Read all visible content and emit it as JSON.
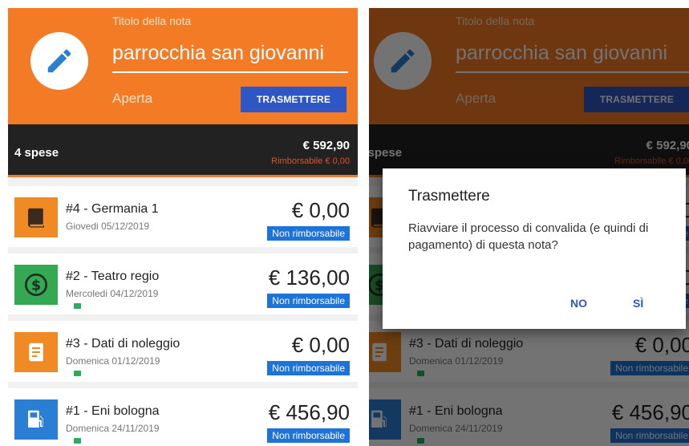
{
  "note": {
    "title_label": "Titolo della nota",
    "title_value": "parrocchia san giovanni",
    "status": "Aperta",
    "transmit_label": "TRASMETTERE"
  },
  "summary": {
    "count_label": "4 spese",
    "total": "€ 592,90",
    "reimbursable": "Rimborsabile  € 0,00"
  },
  "expenses": [
    {
      "title": "#4 - Germania 1",
      "date": "Giovedi 05/12/2019",
      "amount": "€ 0,00",
      "badge": "Non rimborsabile",
      "icon": "book-icon",
      "color": "#f08a24",
      "attachment": false
    },
    {
      "title": "#2 - Teatro regio",
      "date": "Mercoledi 04/12/2019",
      "amount": "€ 136,00",
      "badge": "Non rimborsabile",
      "icon": "dollar-icon",
      "color": "#35a853",
      "attachment": true
    },
    {
      "title": "#3 - Dati di noleggio",
      "date": "Domenica 01/12/2019",
      "amount": "€ 0,00",
      "badge": "Non rimborsabile",
      "icon": "notebook-icon",
      "color": "#f08a24",
      "attachment": true
    },
    {
      "title": "#1 - Eni bologna",
      "date": "Domenica 24/11/2019",
      "amount": "€ 456,90",
      "badge": "Non rimborsabile",
      "icon": "fuel-pump-icon",
      "color": "#2a7fd4",
      "attachment": true
    }
  ],
  "dialog": {
    "title": "Trasmettere",
    "message": "Riavviare il processo di convalida (e quindi di pagamento) di questa nota?",
    "no_label": "NO",
    "yes_label": "SÌ"
  },
  "colors": {
    "header": "#f37b25",
    "summary": "#222222",
    "button": "#2f56c5",
    "badge": "#1e73d8",
    "reimbursable": "#e0522a"
  }
}
